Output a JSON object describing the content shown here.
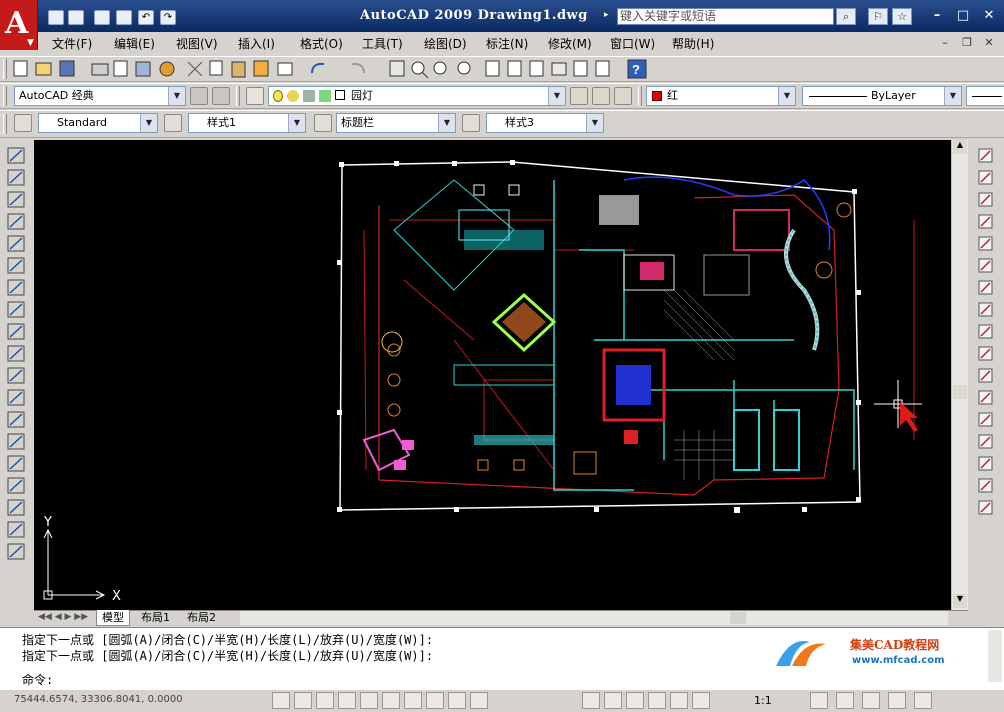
{
  "window": {
    "title": "AutoCAD 2009 Drawing1.dwg",
    "search_placeholder": "键入关键字或短语"
  },
  "menu": [
    "文件(F)",
    "编辑(E)",
    "视图(V)",
    "插入(I)",
    "格式(O)",
    "工具(T)",
    "绘图(D)",
    "标注(N)",
    "修改(M)",
    "窗口(W)",
    "帮助(H)"
  ],
  "toolbar": {
    "workspace": "AutoCAD 经典",
    "layer": "园灯",
    "color": "红",
    "linetype": "ByLayer",
    "text_style": "Standard",
    "dim_style": "样式1",
    "table_style": "标题栏",
    "multileader_style": "样式3"
  },
  "layout_tabs": [
    "模型",
    "布局1",
    "布局2"
  ],
  "ucs": {
    "x": "X",
    "y": "Y"
  },
  "command": {
    "history": [
      "指定下一点或 [圆弧(A)/闭合(C)/半宽(H)/长度(L)/放弃(U)/宽度(W)]:",
      "指定下一点或 [圆弧(A)/闭合(C)/半宽(H)/长度(L)/放弃(U)/宽度(W)]:"
    ],
    "prompt": "命令:"
  },
  "status": {
    "coordinates": "75444.6574, 33306.8041, 0.0000",
    "scale": "1:1"
  },
  "watermark": {
    "brand": "集美CAD教程网",
    "url": "www.mfcad.com"
  },
  "colors": {
    "title_bg": "#0b2a63",
    "drawing_bg": "#000000",
    "accent_red": "#c41a1a"
  },
  "icons": {
    "left_toolbar": [
      "line-icon",
      "construction-line-icon",
      "polyline-icon",
      "polygon-icon",
      "rectangle-icon",
      "arc-icon",
      "circle-icon",
      "revision-cloud-icon",
      "spline-icon",
      "ellipse-icon",
      "ellipse-arc-icon",
      "insert-block-icon",
      "make-block-icon",
      "point-icon",
      "hatch-icon",
      "gradient-icon",
      "region-icon",
      "table-icon",
      "multiline-text-icon"
    ],
    "right_toolbar": [
      "erase-icon",
      "copy-icon",
      "mirror-icon",
      "offset-icon",
      "array-icon",
      "move-icon",
      "rotate-icon",
      "scale-icon",
      "stretch-icon",
      "trim-icon",
      "extend-icon",
      "break-at-point-icon",
      "break-icon",
      "join-icon",
      "chamfer-icon",
      "fillet-icon",
      "explode-icon"
    ]
  }
}
